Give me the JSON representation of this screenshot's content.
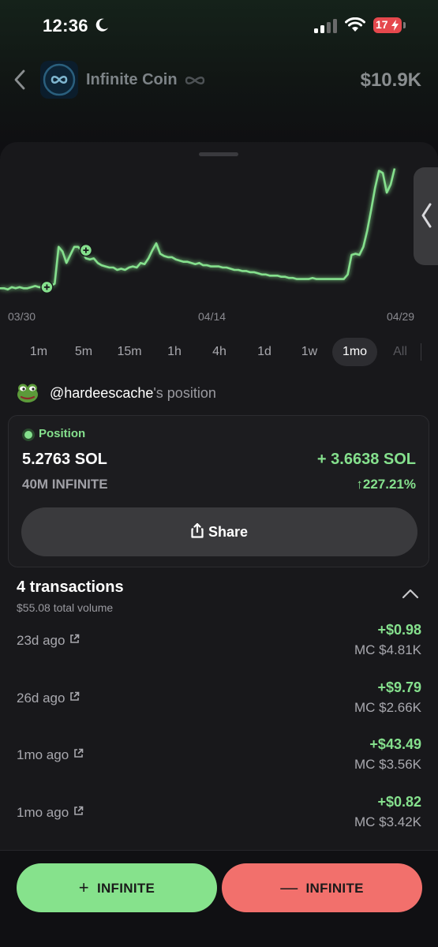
{
  "status_bar": {
    "time": "12:36",
    "battery": "17"
  },
  "header": {
    "coin_name": "Infinite Coin",
    "market_cap": "$10.9K",
    "coin_icon": "infinity-logo-icon"
  },
  "chart_data": {
    "type": "line",
    "x_ticks": [
      "03/30",
      "04/14",
      "04/29"
    ],
    "ylim": [
      0,
      100
    ],
    "series": [
      {
        "color": "#85e08d",
        "values": [
          8,
          8,
          7,
          9,
          8,
          9,
          8,
          8,
          9,
          10,
          9,
          9,
          10,
          10,
          12,
          44,
          40,
          30,
          37,
          44,
          44,
          40,
          34,
          33,
          34,
          30,
          28,
          27,
          26,
          26,
          24,
          25,
          24,
          26,
          27,
          26,
          30,
          29,
          34,
          41,
          47,
          38,
          36,
          35,
          35,
          33,
          32,
          31,
          31,
          30,
          29,
          30,
          28,
          28,
          27,
          27,
          27,
          26,
          26,
          25,
          24,
          24,
          23,
          23,
          22,
          22,
          21,
          20,
          20,
          19,
          19,
          19,
          18,
          18,
          17,
          17,
          16,
          16,
          16,
          16,
          17,
          16,
          16,
          16,
          16,
          16,
          16,
          16,
          16,
          20,
          37,
          38,
          37,
          44,
          58,
          76,
          95,
          110,
          108,
          91,
          98,
          112
        ]
      }
    ],
    "buy_markers": [
      {
        "x": 12,
        "y": 9
      },
      {
        "x": 22,
        "y": 41
      }
    ]
  },
  "timeframes": [
    "1m",
    "5m",
    "15m",
    "1h",
    "4h",
    "1d",
    "1w",
    "1mo",
    "All"
  ],
  "active_timeframe": "1mo",
  "position": {
    "owner_handle": "@hardeescache",
    "owner_suffix": "'s position",
    "title": "Position",
    "sol_amount": "5.2763 SOL",
    "token_amount": "40M INFINITE",
    "pnl_sol": "+ 3.6638 SOL",
    "pnl_pct": "↑227.21%",
    "share_label": "Share"
  },
  "transactions": {
    "title": "4 transactions",
    "volume": "$55.08 total volume",
    "rows": [
      {
        "time": "23d ago",
        "amount": "+$0.98",
        "mc": "MC $4.81K"
      },
      {
        "time": "26d ago",
        "amount": "+$9.79",
        "mc": "MC $2.66K"
      },
      {
        "time": "1mo ago",
        "amount": "+$43.49",
        "mc": "MC $3.56K"
      },
      {
        "time": "1mo ago",
        "amount": "+$0.82",
        "mc": "MC $3.42K"
      }
    ]
  },
  "actions": {
    "buy_label": "INFINITE",
    "sell_label": "INFINITE"
  },
  "colors": {
    "accent_green": "#85e08d",
    "sell_red": "#f2706c",
    "background": "#18181b"
  }
}
